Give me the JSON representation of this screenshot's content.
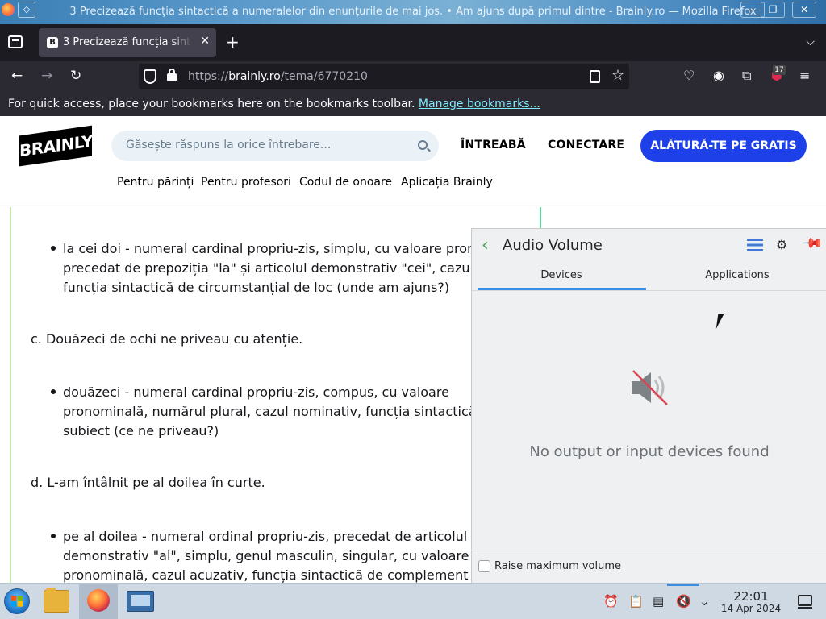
{
  "window": {
    "title": "3 Precizează funcția sintactică a numeralelor din enunțurile de mai jos. • Am ajuns după primul dintre - Brainly.ro — Mozilla Firefox"
  },
  "browser": {
    "tab_label": "3 Precizează funcția sint",
    "tab_favicon": "B",
    "url_prefix": "https://",
    "url_host": "brainly.ro",
    "url_path": "/tema/6770210",
    "extension_badge": "17",
    "bookmarks_message": "For quick access, place your bookmarks here on the bookmarks toolbar.",
    "bookmarks_link": "Manage bookmarks..."
  },
  "site": {
    "logo_text": "BRAINLY",
    "search_placeholder": "Găsește răspuns la orice întrebare...",
    "ask_label": "ÎNTREABĂ",
    "login_label": "CONECTARE",
    "join_label": "ALĂTURĂ-TE PE GRATIS",
    "sub_links": [
      "Pentru părinți",
      "Pentru profesori",
      "Codul de onoare",
      "Aplicația Brainly"
    ]
  },
  "content": {
    "bullet1_lines": [
      "la cei doi - numeral cardinal propriu-zis, simplu, cu valoare pronom",
      "precedat de prepoziția \"la\" și articolul demonstrativ \"cei\", cazul ac",
      "funcția sintactică de circumstanțial de loc (unde am ajuns?)"
    ],
    "sentence_c": "c. Douăzeci de ochi ne priveau cu atenție.",
    "bullet2_lines": [
      "douăzeci - numeral cardinal propriu-zis, compus, cu valoare",
      "pronominală, numărul plural, cazul nominativ, funcția sintactică de",
      "subiect (ce ne priveau?)"
    ],
    "sentence_d": "d. L-am întâlnit pe al doilea în curte.",
    "bullet3_lines": [
      "pe al doilea - numeral ordinal propriu-zis, precedat de articolul",
      "demonstrativ \"al\", simplu, genul masculin, singular, cu valoare",
      "pronominală, cazul acuzativ, funcția sintactică de complement dir"
    ]
  },
  "audio_panel": {
    "title": "Audio Volume",
    "tabs": [
      "Devices",
      "Applications"
    ],
    "active_tab": "Devices",
    "empty_message": "No output or input devices found",
    "raise_max_label": "Raise maximum volume",
    "raise_max_checked": false
  },
  "taskbar": {
    "time": "22:01",
    "date": "14 Apr 2024"
  },
  "colors": {
    "brainly_blue": "#1d40e8",
    "accent_blue": "#3d8ee0",
    "firefox_dark": "#1c1b22"
  }
}
